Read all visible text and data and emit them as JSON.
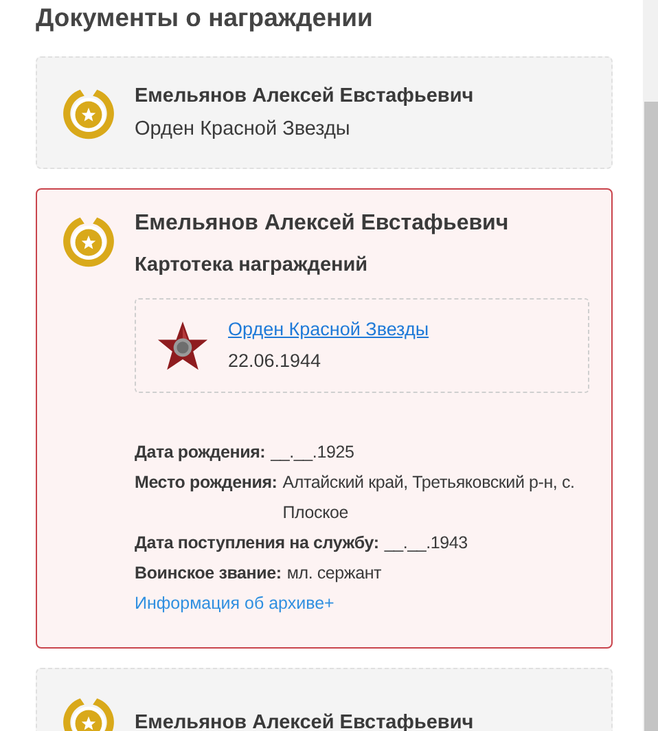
{
  "heading": "Документы о награждении",
  "documents": [
    {
      "name": "Емельянов Алексей Евстафьевич",
      "subtitle": "Орден Красной Звезды",
      "selected": false
    },
    {
      "name": "Емельянов Алексей Евстафьевич",
      "subtitle": "Картотека награждений",
      "selected": true,
      "award": {
        "title": "Орден Красной Звезды",
        "date": "22.06.1944"
      },
      "facts": [
        {
          "label": "Дата рождения:",
          "value": "__.__.1925"
        },
        {
          "label": "Место рождения:",
          "value": "Алтайский край, Третьяковский р-н, с. Плоское"
        },
        {
          "label": "Дата поступления на службу:",
          "value": "__.__.1943"
        },
        {
          "label": "Воинское звание:",
          "value": "мл. сержант"
        }
      ],
      "archive_link": "Информация об архиве+"
    },
    {
      "name": "Емельянов Алексей Евстафьевич",
      "selected": false
    }
  ]
}
